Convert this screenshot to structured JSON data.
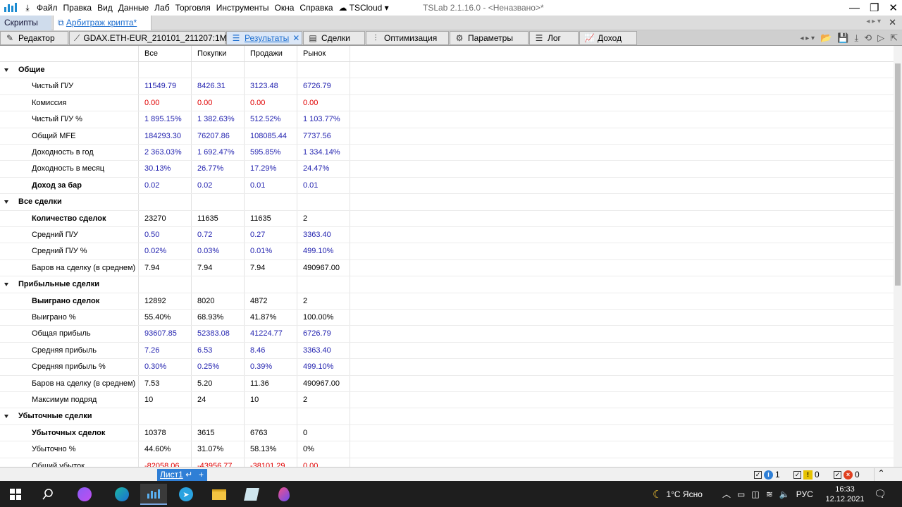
{
  "menubar": {
    "items": [
      "Файл",
      "Правка",
      "Вид",
      "Данные",
      "Лаб",
      "Торговля",
      "Инструменты",
      "Окна",
      "Справка",
      "TSCloud"
    ],
    "window_title": "TSLab 2.1.16.0 - <Неназвано>*"
  },
  "tabs_top": {
    "scripts": "Скрипты",
    "active": "Арбитраж крипта*"
  },
  "tabs_secondary": {
    "editor": "Редактор",
    "data": "GDAX.ETH-EUR_210101_211207:1M",
    "results": "Результаты",
    "trades": "Сделки",
    "optimization": "Оптимизация",
    "params": "Параметры",
    "log": "Лог",
    "income": "Доход"
  },
  "table": {
    "headers": [
      "Все",
      "Покупки",
      "Продажи",
      "Рынок"
    ],
    "rows": [
      {
        "type": "section",
        "label": "Общие"
      },
      {
        "label": "Чистый П/У",
        "values": [
          "11549.79",
          "8426.31",
          "3123.48",
          "6726.79"
        ],
        "color": "blue"
      },
      {
        "label": "Комиссия",
        "values": [
          "0.00",
          "0.00",
          "0.00",
          "0.00"
        ],
        "color": "red"
      },
      {
        "label": "Чистый П/У %",
        "values": [
          "1 895.15%",
          "1 382.63%",
          "512.52%",
          "1 103.77%"
        ],
        "color": "blue"
      },
      {
        "label": "Общий MFE",
        "values": [
          "184293.30",
          "76207.86",
          "108085.44",
          "7737.56"
        ],
        "color": "blue"
      },
      {
        "label": "Доходность в год",
        "values": [
          "2 363.03%",
          "1 692.47%",
          "595.85%",
          "1 334.14%"
        ],
        "color": "blue"
      },
      {
        "label": "Доходность в месяц",
        "values": [
          "30.13%",
          "26.77%",
          "17.29%",
          "24.47%"
        ],
        "color": "blue"
      },
      {
        "label": "Доход за бар",
        "values": [
          "0.02",
          "0.02",
          "0.01",
          "0.01"
        ],
        "color": "blue",
        "bold": true
      },
      {
        "type": "section",
        "label": "Все сделки"
      },
      {
        "label": "Количество сделок",
        "values": [
          "23270",
          "11635",
          "11635",
          "2"
        ],
        "color": "black",
        "bold": true
      },
      {
        "label": "Средний П/У",
        "values": [
          "0.50",
          "0.72",
          "0.27",
          "3363.40"
        ],
        "color": "blue"
      },
      {
        "label": "Средний П/У %",
        "values": [
          "0.02%",
          "0.03%",
          "0.01%",
          "499.10%"
        ],
        "color": "blue"
      },
      {
        "label": "Баров на сделку (в среднем)",
        "values": [
          "7.94",
          "7.94",
          "7.94",
          "490967.00"
        ],
        "color": "black"
      },
      {
        "type": "section",
        "label": "Прибыльные сделки"
      },
      {
        "label": "Выиграно сделок",
        "values": [
          "12892",
          "8020",
          "4872",
          "2"
        ],
        "color": "black",
        "bold": true
      },
      {
        "label": "Выиграно %",
        "values": [
          "55.40%",
          "68.93%",
          "41.87%",
          "100.00%"
        ],
        "color": "black"
      },
      {
        "label": "Общая прибыль",
        "values": [
          "93607.85",
          "52383.08",
          "41224.77",
          "6726.79"
        ],
        "color": "blue"
      },
      {
        "label": "Средняя прибыль",
        "values": [
          "7.26",
          "6.53",
          "8.46",
          "3363.40"
        ],
        "color": "blue"
      },
      {
        "label": "Средняя прибыль %",
        "values": [
          "0.30%",
          "0.25%",
          "0.39%",
          "499.10%"
        ],
        "color": "blue"
      },
      {
        "label": "Баров на сделку (в среднем)",
        "values": [
          "7.53",
          "5.20",
          "11.36",
          "490967.00"
        ],
        "color": "black"
      },
      {
        "label": "Максимум подряд",
        "values": [
          "10",
          "24",
          "10",
          "2"
        ],
        "color": "black"
      },
      {
        "type": "section",
        "label": "Убыточные сделки"
      },
      {
        "label": "Убыточных сделок",
        "values": [
          "10378",
          "3615",
          "6763",
          "0"
        ],
        "color": "black",
        "bold": true
      },
      {
        "label": "Убыточно %",
        "values": [
          "44.60%",
          "31.07%",
          "58.13%",
          "0%"
        ],
        "color": "black"
      },
      {
        "label": "Общий убыток",
        "values": [
          "-82058.06",
          "-43956.77",
          "-38101.29",
          "0.00"
        ],
        "color": "red"
      }
    ]
  },
  "statusbar": {
    "sheet": "Лист1",
    "info_count": "1",
    "warn_count": "0",
    "error_count": "0"
  },
  "taskbar": {
    "weather": "1°C Ясно",
    "lang": "РУС",
    "time": "16:33",
    "date": "12.12.2021"
  },
  "colors": {
    "accent": "#1e6fd0",
    "value_blue": "#2424b0",
    "value_red": "#e00000"
  }
}
